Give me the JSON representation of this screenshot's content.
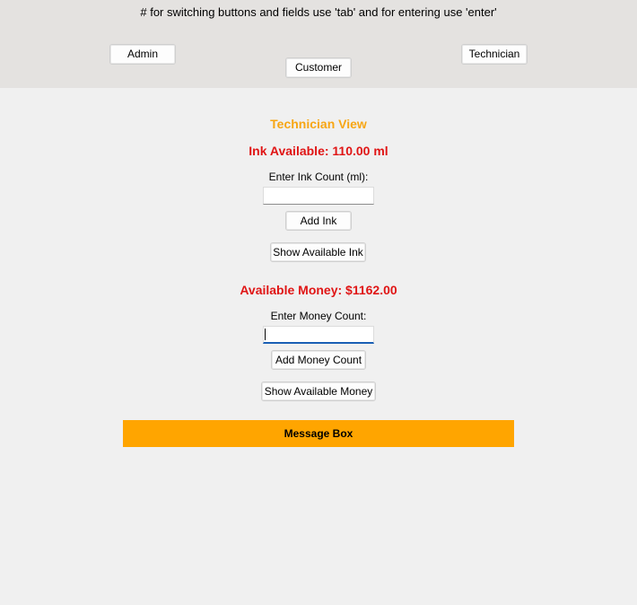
{
  "hint": "# for switching buttons and fields use 'tab' and for entering use 'enter'",
  "nav": {
    "admin": "Admin",
    "customer": "Customer",
    "technician": "Technician"
  },
  "view_title": "Technician View",
  "ink": {
    "available": "Ink Available: 110.00 ml",
    "label": "Enter Ink Count (ml):",
    "value": "",
    "add_button": "Add Ink",
    "show_button": "Show Available Ink"
  },
  "money": {
    "available": "Available Money: $1162.00",
    "label": "Enter Money Count:",
    "value": "",
    "add_button": "Add Money Count",
    "show_button": "Show Available Money"
  },
  "message_box": "Message Box",
  "colors": {
    "title": "#f7a614",
    "status": "#e01515",
    "message_bg": "#ffa500"
  }
}
